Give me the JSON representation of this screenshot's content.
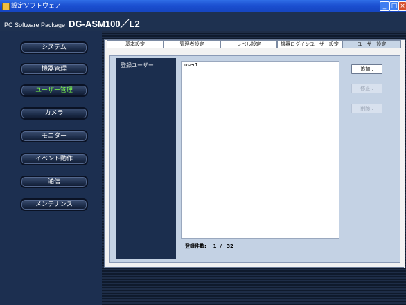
{
  "window": {
    "title": "設定ソフトウェア"
  },
  "header": {
    "prefix": "PC Software Package",
    "product": "DG-ASM100／L2"
  },
  "sidebar": {
    "items": [
      {
        "label": "システム"
      },
      {
        "label": "機器管理"
      },
      {
        "label": "ユーザー管理",
        "active": true
      },
      {
        "label": "カメラ"
      },
      {
        "label": "モニター"
      },
      {
        "label": "イベント動作"
      },
      {
        "label": "通信"
      },
      {
        "label": "メンテナンス"
      }
    ]
  },
  "tabs": [
    {
      "label": "基本設定"
    },
    {
      "label": "管理者設定"
    },
    {
      "label": "レベル設定"
    },
    {
      "label": "機器ログインユーザー設定"
    },
    {
      "label": "ユーザー設定",
      "active": true
    }
  ],
  "main": {
    "registered_users_label": "登録ユーザー",
    "users": [
      "user1"
    ],
    "count_label": "登録件数:",
    "count_current": "1",
    "count_separator": "/",
    "count_max": "32",
    "buttons": {
      "add": "追加..",
      "edit": "修正..",
      "delete": "削除.."
    }
  },
  "colors": {
    "sidebar_bg": "#1c2f50",
    "active_text": "#7dff4a",
    "content_bg": "#c4d2e4"
  }
}
